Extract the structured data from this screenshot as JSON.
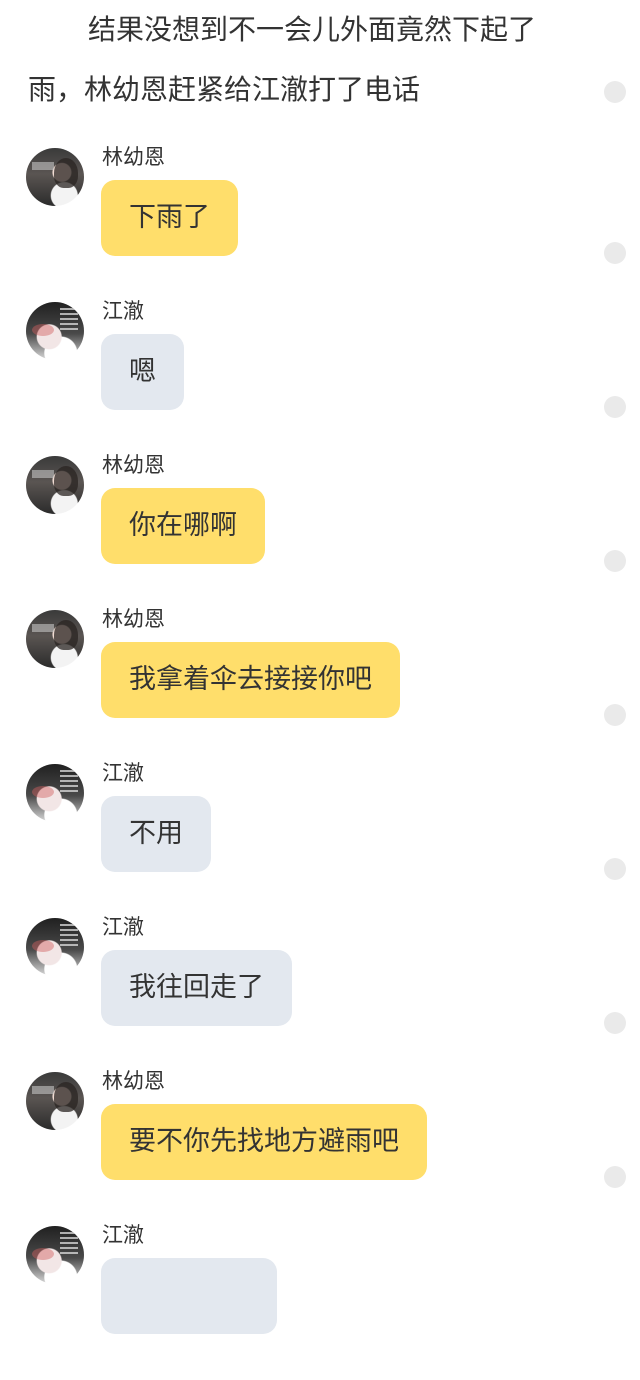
{
  "narration": "结果没想到不一会儿外面竟然下起了雨，林幼恩赶紧给江澈打了电话",
  "messages": [
    {
      "sender": "林幼恩",
      "text": "下雨了",
      "side": "yellow",
      "avatar": "lin-youen-avatar"
    },
    {
      "sender": "江澈",
      "text": "嗯",
      "side": "gray",
      "avatar": "jiang-che-avatar"
    },
    {
      "sender": "林幼恩",
      "text": "你在哪啊",
      "side": "yellow",
      "avatar": "lin-youen-avatar"
    },
    {
      "sender": "林幼恩",
      "text": "我拿着伞去接接你吧",
      "side": "yellow",
      "avatar": "lin-youen-avatar"
    },
    {
      "sender": "江澈",
      "text": "不用",
      "side": "gray",
      "avatar": "jiang-che-avatar"
    },
    {
      "sender": "江澈",
      "text": "我往回走了",
      "side": "gray",
      "avatar": "jiang-che-avatar"
    },
    {
      "sender": "林幼恩",
      "text": "要不你先找地方避雨吧",
      "side": "yellow",
      "avatar": "lin-youen-avatar"
    },
    {
      "sender": "江澈",
      "text": "",
      "side": "gray",
      "avatar": "jiang-che-avatar"
    }
  ],
  "colors": {
    "yellow_bubble": "#ffde6b",
    "gray_bubble": "#e3e8ef",
    "text": "#333333"
  }
}
